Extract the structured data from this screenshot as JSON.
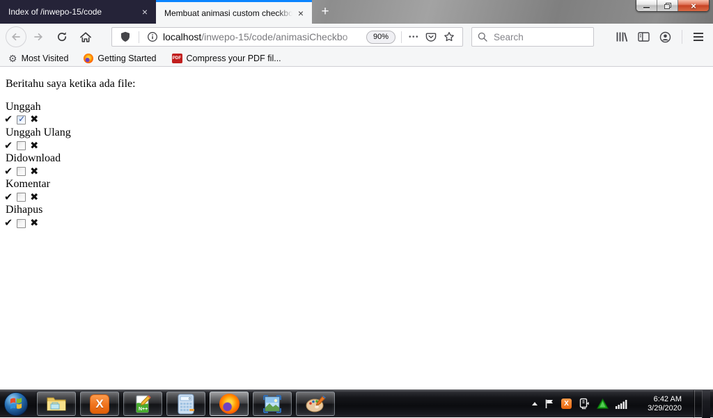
{
  "titlebar": {
    "tabs": [
      {
        "title": "Index of /inwepo-15/code",
        "active": false
      },
      {
        "title": "Membuat animasi custom checkbo",
        "active": true
      }
    ],
    "close_glyph": "×",
    "new_tab_glyph": "+"
  },
  "navbar": {
    "url": {
      "host": "localhost",
      "path": "/inwepo-15/code/animasiCheckbo"
    },
    "zoom_badge": "90%",
    "dots_glyph": "•••",
    "search_placeholder": "Search"
  },
  "bookmarks_bar": {
    "gear_glyph": "⚙",
    "pdf_label": "PDF",
    "items": [
      {
        "label": "Most Visited",
        "icon": "gear-icon"
      },
      {
        "label": "Getting Started",
        "icon": "firefox-icon"
      },
      {
        "label": "Compress your PDF fil...",
        "icon": "pdf-icon"
      }
    ]
  },
  "page": {
    "intro": "Beritahu saya ketika ada file:",
    "check_glyph": "✔",
    "cross_glyph": "✖",
    "items": [
      {
        "label": "Unggah",
        "checked": true
      },
      {
        "label": "Unggah Ulang",
        "checked": false
      },
      {
        "label": "Didownload",
        "checked": false
      },
      {
        "label": "Komentar",
        "checked": false
      },
      {
        "label": "Dihapus",
        "checked": false
      }
    ]
  },
  "taskbar": {
    "apps": [
      "windows-explorer",
      "xampp-control-panel",
      "notepad-plus-plus",
      "calculator",
      "firefox",
      "windows-photo-viewer",
      "paint"
    ],
    "active_app": "firefox",
    "xampp_letter": "X",
    "clock": {
      "time": "6:42 AM",
      "date": "3/29/2020"
    }
  },
  "colors": {
    "accent_blue": "#0a84ff",
    "inactive_tab_bg": "#252338",
    "toolbar_bg": "#f5f6f7",
    "xampp_orange": "#f0731d",
    "pdf_red": "#c11e1e",
    "close_button_red": "#c74324",
    "check_blue": "#2b4f9e"
  }
}
